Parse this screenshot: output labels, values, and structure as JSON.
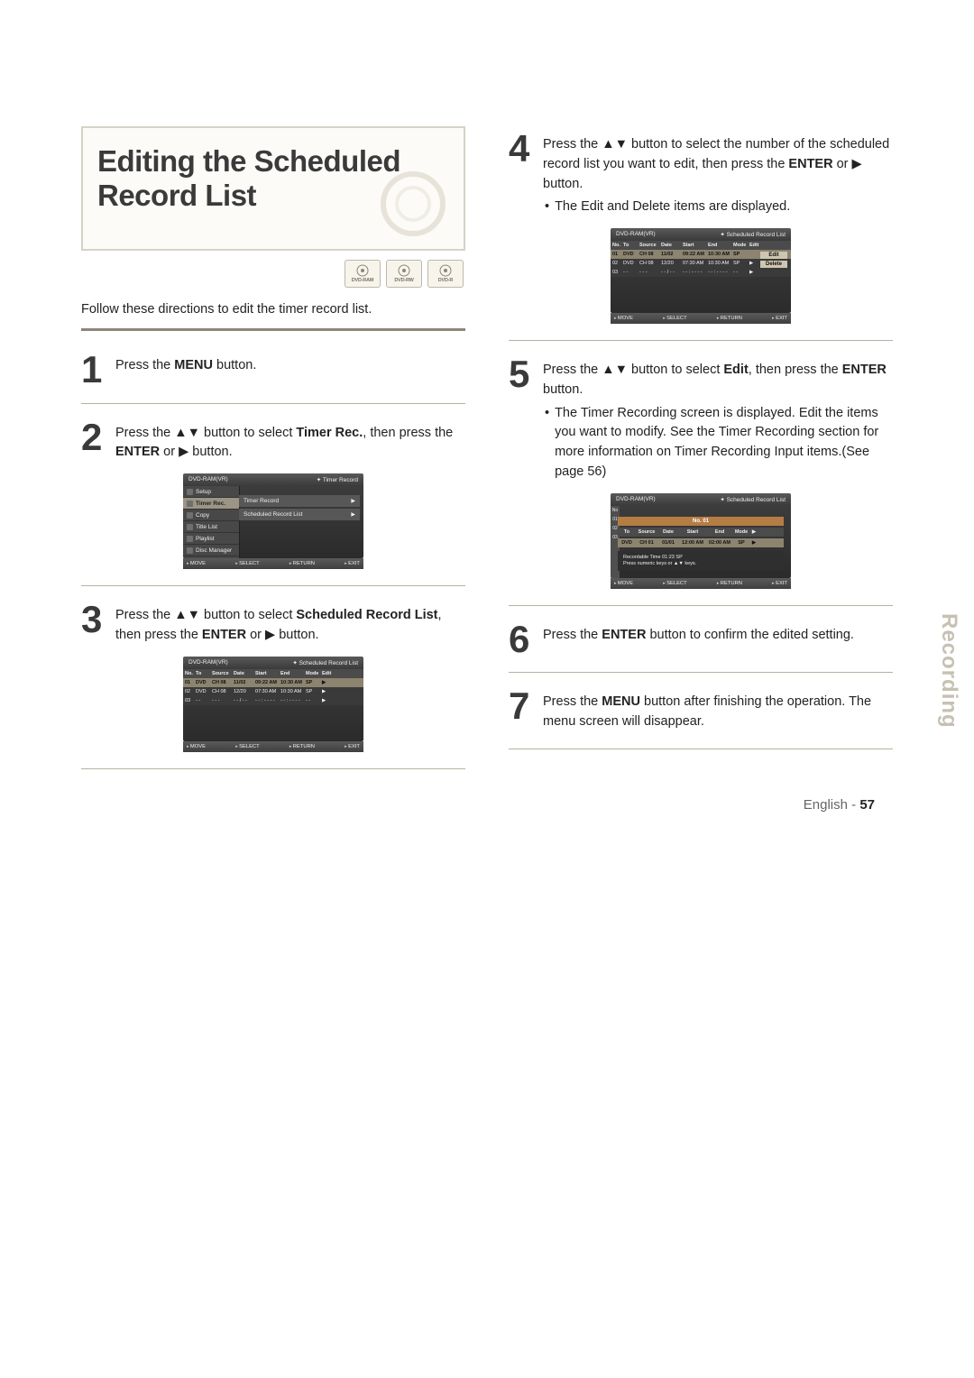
{
  "title": "Editing the Scheduled Record List",
  "disc_badges": [
    "DVD-RAM",
    "DVD-RW",
    "DVD-R"
  ],
  "intro": "Follow these directions to edit the timer record list.",
  "steps": {
    "s1": {
      "t": "Press the ",
      "b1": "MENU",
      "t2": " button."
    },
    "s2": {
      "t": "Press the ▲▼ button to select ",
      "b1": "Timer Rec.",
      "t2": ", then press the ",
      "b2": "ENTER",
      "t3": " or ▶ button."
    },
    "s3": {
      "t": "Press the ▲▼ button to select ",
      "b1": "Scheduled Record List",
      "t2": ", then press the ",
      "b2": "ENTER",
      "t3": " or  ▶ button."
    },
    "s4": {
      "t": "Press the ▲▼ button to select the number of the scheduled record list you want to edit, then press the ",
      "b1": "ENTER",
      "t2": " or ▶ button."
    },
    "s4_bullet": "The Edit and Delete items are displayed.",
    "s5": {
      "t": "Press the ▲▼ button to select ",
      "b1": "Edit",
      "t2": ", then press the ",
      "b2": "ENTER",
      "t3": " button."
    },
    "s5_bullet": "The Timer Recording screen is displayed. Edit the items you want to modify. See the Timer Recording section for more information on Timer Recording Input items.(See page 56)",
    "s6": {
      "t": "Press the ",
      "b1": "ENTER",
      "t2": " button to confirm the edited setting."
    },
    "s7": {
      "t": "Press the ",
      "b1": "MENU",
      "t2": " button after finishing the operation. The menu screen will disappear."
    }
  },
  "osd": {
    "device": "DVD-RAM(VR)",
    "footer": {
      "move": "MOVE",
      "select": "SELECT",
      "return": "RETURN",
      "exit": "EXIT"
    },
    "timer_title": "Timer Record",
    "menu_items": [
      "Setup",
      "Timer Rec.",
      "Copy",
      "Title List",
      "Playlist",
      "Disc Manager"
    ],
    "menu_right": [
      "Timer Record",
      "Scheduled Record List"
    ],
    "srl_title": "Scheduled Record List",
    "cols": [
      "No.",
      "To",
      "Source",
      "Date",
      "Start",
      "End",
      "Mode",
      "Edit"
    ],
    "rows": [
      {
        "no": "01",
        "to": "DVD",
        "src": "CH 08",
        "date": "11/02",
        "start": "09:22 AM",
        "end": "10:30 AM",
        "mode": "SP"
      },
      {
        "no": "02",
        "to": "DVD",
        "src": "CH 08",
        "date": "12/20",
        "start": "07:30 AM",
        "end": "10:30 AM",
        "mode": "SP"
      },
      {
        "no": "03",
        "to": "- -",
        "src": "- - -",
        "date": "- - / - -",
        "start": "- - : - - - -",
        "end": "- - : - - - -",
        "mode": "- -"
      }
    ],
    "popup": [
      "Edit",
      "Delete"
    ],
    "modal": {
      "title": "No. 01",
      "hdr": [
        "To",
        "Source",
        "Date",
        "Start",
        "End",
        "Mode"
      ],
      "row": [
        "DVD",
        "CH 01",
        "01/01",
        "12:00 AM",
        "02:00 AM",
        "SP"
      ],
      "tip1": "Recordable Time 01:23 SP",
      "tip2": "Press numeric keys or ▲▼ keys."
    }
  },
  "side_label": "Recording",
  "footer_lang": "English",
  "footer_page": "57"
}
